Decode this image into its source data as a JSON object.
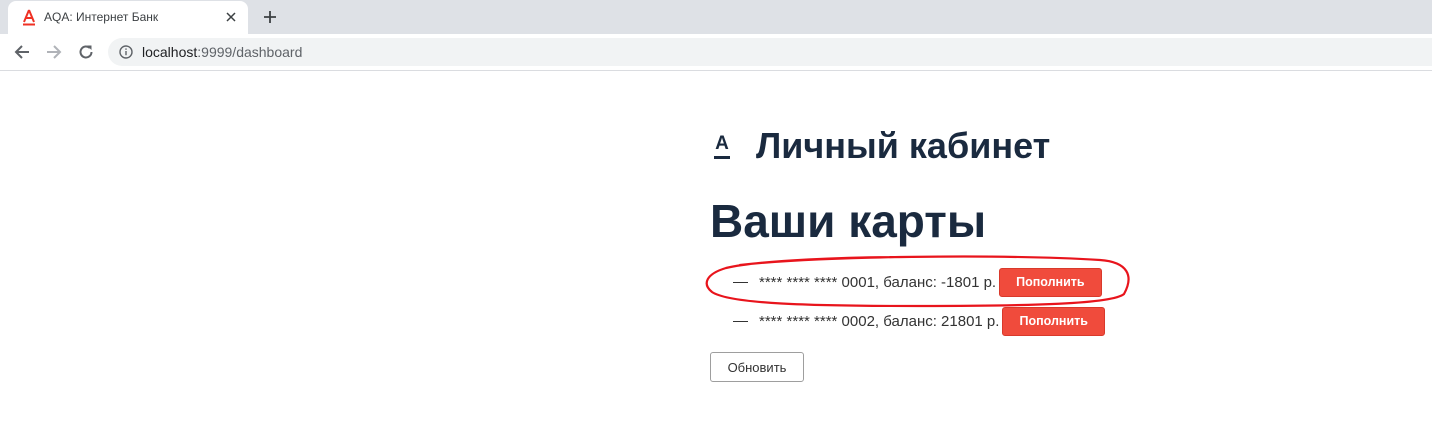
{
  "browser": {
    "tab_title": "AQA: Интернет Банк",
    "url_host": "localhost",
    "url_rest": ":9999/dashboard"
  },
  "page": {
    "logo_letter": "A",
    "cabinet_title": "Личный кабинет",
    "cards_title": "Ваши карты",
    "cards": [
      {
        "text": "**** **** **** 0001, баланс: -1801 р.",
        "button_label": "Пополнить",
        "highlighted": true
      },
      {
        "text": "**** **** **** 0002, баланс: 21801 р.",
        "button_label": "Пополнить",
        "highlighted": false
      }
    ],
    "refresh_label": "Обновить"
  },
  "colors": {
    "accent_red": "#f04b3c",
    "heading": "#1a2a3f",
    "annotation": "#e8141c"
  },
  "icons": [
    "alfa-favicon-icon",
    "close-icon",
    "plus-icon",
    "back-arrow-icon",
    "forward-arrow-icon",
    "reload-icon",
    "info-icon"
  ]
}
